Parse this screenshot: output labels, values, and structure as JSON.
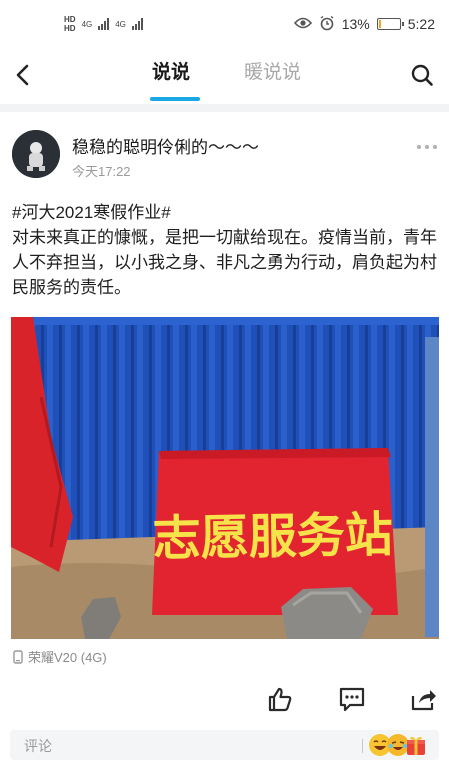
{
  "status_bar": {
    "hd_label_top": "HD",
    "hd_label_bottom": "HD",
    "network_1": "4G",
    "network_2": "4G",
    "alarm_icon": "alarm-icon",
    "eye_icon": "eye-comfort-icon",
    "battery_percent": "13%",
    "battery_level": 0.13,
    "time": "5:22"
  },
  "nav": {
    "back_icon": "back-arrow-icon",
    "tab_active": "说说",
    "tab_inactive": "暖说说",
    "search_icon": "search-icon",
    "accent_color": "#19a7e6"
  },
  "post": {
    "username": "稳稳的聪明伶俐的～～～",
    "time": "今天17:22",
    "text": "#河大2021寒假作业#\n对未来真正的慷慨，是把一切献给现在。疫情当前，青年人不弃担当，以小我之身、非凡之勇为行动，肩负起为村民服务的责任。",
    "photo": {
      "sign_text": "志愿服务站"
    },
    "device": "荣耀V20 (4G)"
  },
  "actions": {
    "like_icon": "thumbs-up-icon",
    "comment_icon": "comment-icon",
    "share_icon": "share-icon"
  },
  "comment_bar": {
    "placeholder": "评论",
    "emoji_icons": [
      "laughing-emoji-icon",
      "crying-laughing-emoji-icon",
      "gift-emoji-icon"
    ]
  }
}
